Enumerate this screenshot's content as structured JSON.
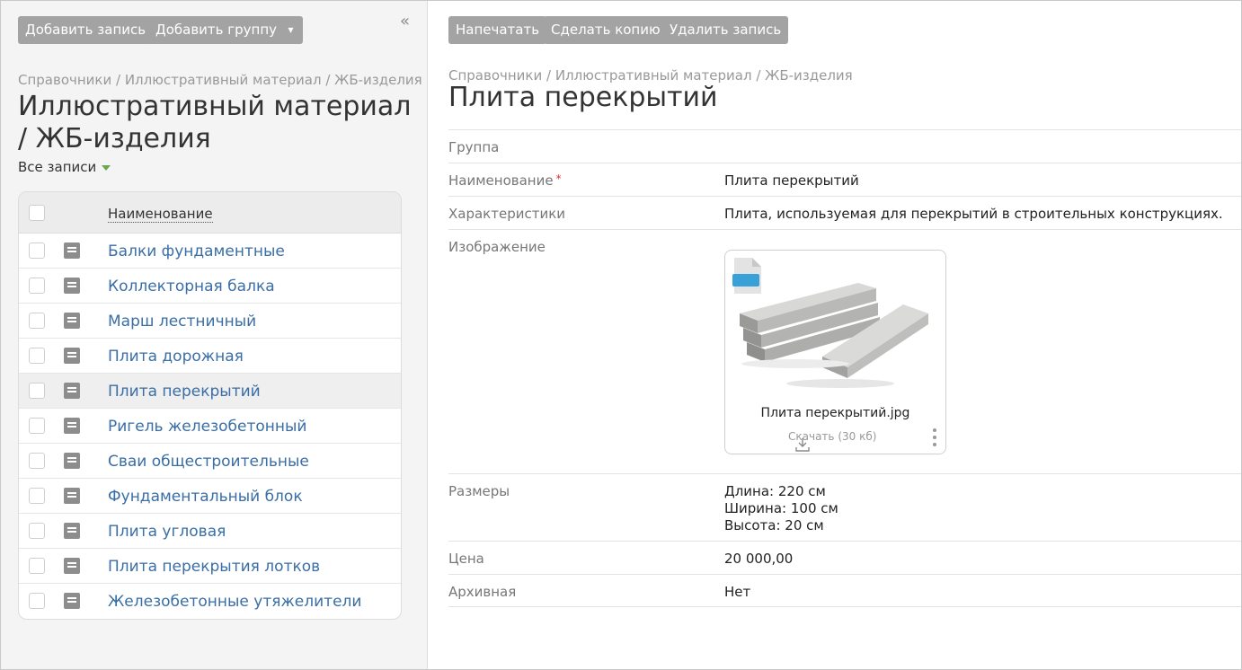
{
  "left": {
    "toolbar": {
      "add_record": "Добавить запись",
      "add_group": "Добавить группу",
      "dropdown": "▾"
    },
    "collapse": "«",
    "breadcrumb": "Справочники / Иллюстративный материал / ЖБ-изделия",
    "title": "Иллюстративный материал / ЖБ-изделия",
    "filter_label": "Все записи",
    "table": {
      "column_name": "Наименование",
      "rows": [
        "Балки фундаментные",
        "Коллекторная балка",
        "Марш лестничный",
        "Плита дорожная",
        "Плита перекрытий",
        "Ригель железобетонный",
        "Сваи общестроительные",
        "Фундаментальный блок",
        "Плита угловая",
        "Плита перекрытия лотков",
        "Железобетонные утяжелители"
      ],
      "selected_index": 4
    }
  },
  "right": {
    "toolbar": {
      "print": "Напечатать",
      "copy": "Сделать копию",
      "delete": "Удалить запись"
    },
    "breadcrumb": "Справочники / Иллюстративный материал / ЖБ-изделия",
    "title": "Плита перекрытий",
    "fields": {
      "group_label": "Группа",
      "group_value": "",
      "name_label": "Наименование",
      "name_required": "*",
      "name_value": "Плита перекрытий",
      "chars_label": "Характеристики",
      "chars_value": "Плита, используемая для перекрытий в строительных конструкциях.",
      "image_label": "Изображение",
      "image": {
        "file_name": "Плита перекрытий.jpg",
        "file_type": "JPG",
        "download_label": "Скачать",
        "size": "(30 кб)"
      },
      "dims_label": "Размеры",
      "dims_lines": [
        "Длина: 220 см",
        "Ширина: 100 см",
        "Высота: 20 см"
      ],
      "price_label": "Цена",
      "price_value": "20 000,00",
      "archive_label": "Архивная",
      "archive_value": "Нет"
    }
  },
  "colors": {
    "button_bg": "#a3a3a3",
    "link": "#3a6ea5",
    "filter_arrow": "#6aa84f",
    "jpg_badge": "#3aa0d8"
  }
}
